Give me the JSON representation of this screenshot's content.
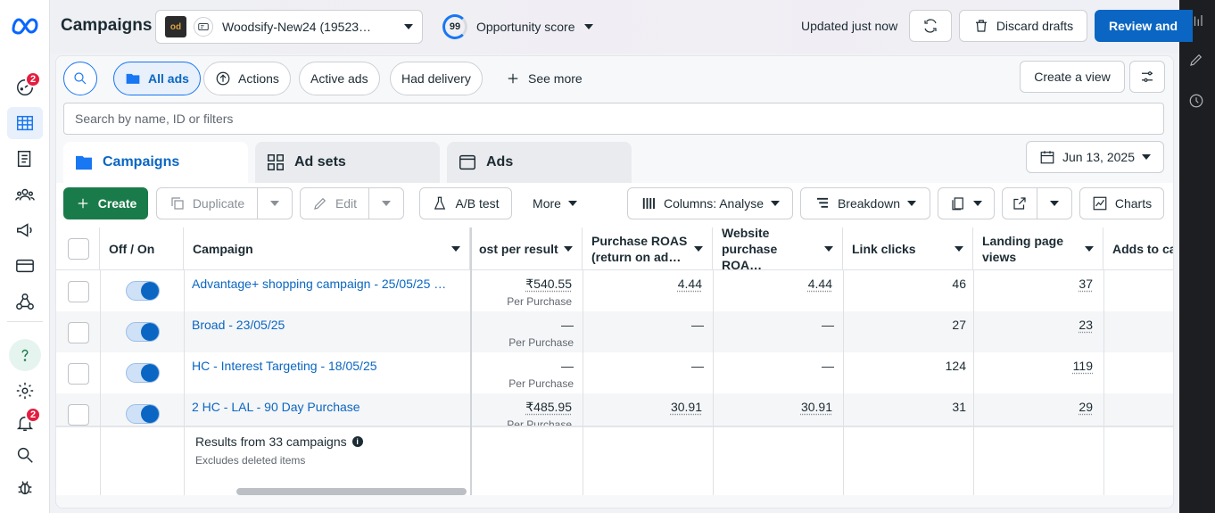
{
  "header": {
    "title": "Campaigns",
    "account_logo_text": "od",
    "account_name": "Woodsify-New24 (19523…",
    "opportunity_score": "99",
    "opportunity_label": "Opportunity score",
    "updated_text": "Updated just now",
    "discard_label": "Discard drafts",
    "review_label": "Review and"
  },
  "rail": {
    "badge_top": "2",
    "badge_notif": "2"
  },
  "filters": {
    "all_ads": "All ads",
    "actions": "Actions",
    "active_ads": "Active ads",
    "had_delivery": "Had delivery",
    "see_more": "See more",
    "create_view": "Create a view",
    "search_placeholder": "Search by name, ID or filters"
  },
  "tabs": {
    "campaigns": "Campaigns",
    "ad_sets": "Ad sets",
    "ads": "Ads",
    "date": "Jun 13, 2025"
  },
  "toolbar": {
    "create": "Create",
    "duplicate": "Duplicate",
    "edit": "Edit",
    "ab_test": "A/B test",
    "more": "More",
    "columns": "Columns: Analyse",
    "breakdown": "Breakdown",
    "charts": "Charts"
  },
  "table": {
    "headers": {
      "offon": "Off / On",
      "campaign": "Campaign",
      "cost": "ost per result",
      "roas1": "Purchase ROAS (return on ad…",
      "roas2": "Website purchase ROA…",
      "link_clicks": "Link clicks",
      "lpv": "Landing page views",
      "adds": "Adds to ca"
    },
    "rows": [
      {
        "name": "Advantage+ shopping campaign - 25/05/25 …",
        "cost": "₹540.55",
        "cost_sub": "Per Purchase",
        "roas1": "4.44",
        "roas2": "4.44",
        "clicks": "46",
        "lpv": "37"
      },
      {
        "name": "Broad - 23/05/25",
        "cost": "—",
        "cost_sub": "Per Purchase",
        "roas1": "—",
        "roas2": "—",
        "clicks": "27",
        "lpv": "23"
      },
      {
        "name": "HC - Interest Targeting - 18/05/25",
        "cost": "—",
        "cost_sub": "Per Purchase",
        "roas1": "—",
        "roas2": "—",
        "clicks": "124",
        "lpv": "119"
      },
      {
        "name": "2 HC - LAL - 90 Day Purchase",
        "cost": "₹485.95",
        "cost_sub": "Per Purchase",
        "roas1": "30.91",
        "roas2": "30.91",
        "clicks": "31",
        "lpv": "29"
      }
    ],
    "results_text": "Results from 33 campaigns",
    "results_sub": "Excludes deleted items"
  }
}
